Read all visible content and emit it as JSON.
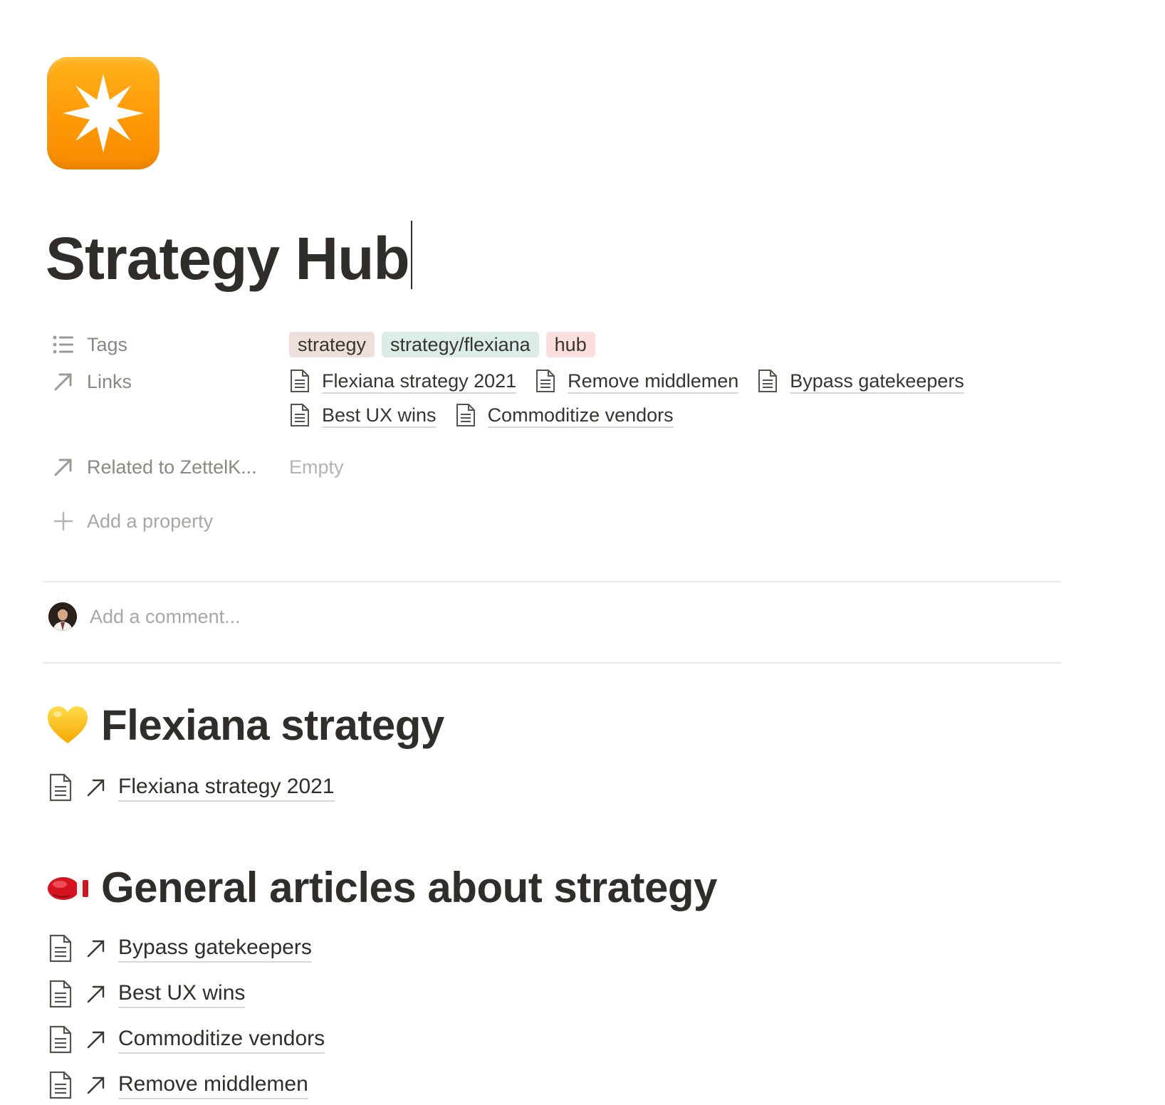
{
  "page": {
    "icon": "eight-pointed-star-icon",
    "title": "Strategy Hub"
  },
  "properties": {
    "tags": {
      "name": "Tags",
      "icon": "list-icon",
      "values": [
        {
          "label": "strategy",
          "color": "#ede0da"
        },
        {
          "label": "strategy/flexiana",
          "color": "#dcece6"
        },
        {
          "label": "hub",
          "color": "#fbdede"
        }
      ]
    },
    "links": {
      "name": "Links",
      "icon": "arrow-up-right-icon",
      "values": [
        "Flexiana strategy 2021",
        "Remove middlemen",
        "Bypass gatekeepers",
        "Best UX wins",
        "Commoditize vendors"
      ]
    },
    "related": {
      "name": "Related to ZettelK...",
      "icon": "arrow-up-right-icon",
      "value": "Empty"
    },
    "add_property": {
      "label": "Add a property",
      "icon": "plus-icon"
    }
  },
  "comment": {
    "placeholder": "Add a comment..."
  },
  "sections": [
    {
      "emoji": "yellow-heart-icon",
      "heading": "Flexiana strategy",
      "items": [
        "Flexiana strategy 2021"
      ]
    },
    {
      "emoji": "boxing-glove-icon",
      "heading": "General articles about strategy",
      "items": [
        "Bypass gatekeepers",
        "Best UX wins",
        "Commoditize vendors",
        "Remove middlemen"
      ]
    }
  ]
}
